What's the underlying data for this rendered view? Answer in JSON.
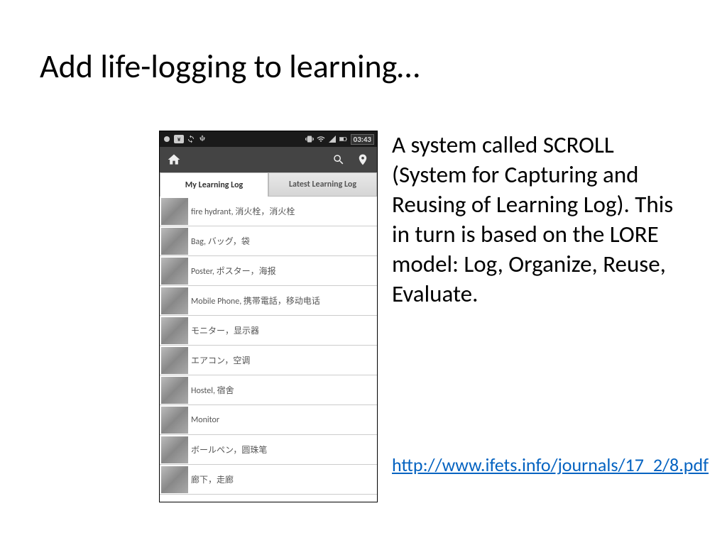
{
  "title": "Add life-logging to learning…",
  "body": "A system called SCROLL (System for Capturing and Reusing of Learning Log). This in turn is based on the LORE model: Log, Organize, Reuse, Evaluate.",
  "link": "http://www.ifets.info/journals/17_2/8.pdf",
  "phone": {
    "clock": "03:43",
    "tabs": {
      "active": "My Learning Log",
      "inactive": "Latest Learning Log"
    },
    "items": [
      "fire hydrant, 消火栓，消火栓",
      "Bag, バッグ，袋",
      "Poster, ポスター，海报",
      "Mobile Phone, 携帯電話，移动电话",
      "モニター，显示器",
      "エアコン，空调",
      "Hostel, 宿舍",
      "Monitor",
      "ボールペン，圆珠笔",
      "廊下，走廊"
    ]
  }
}
